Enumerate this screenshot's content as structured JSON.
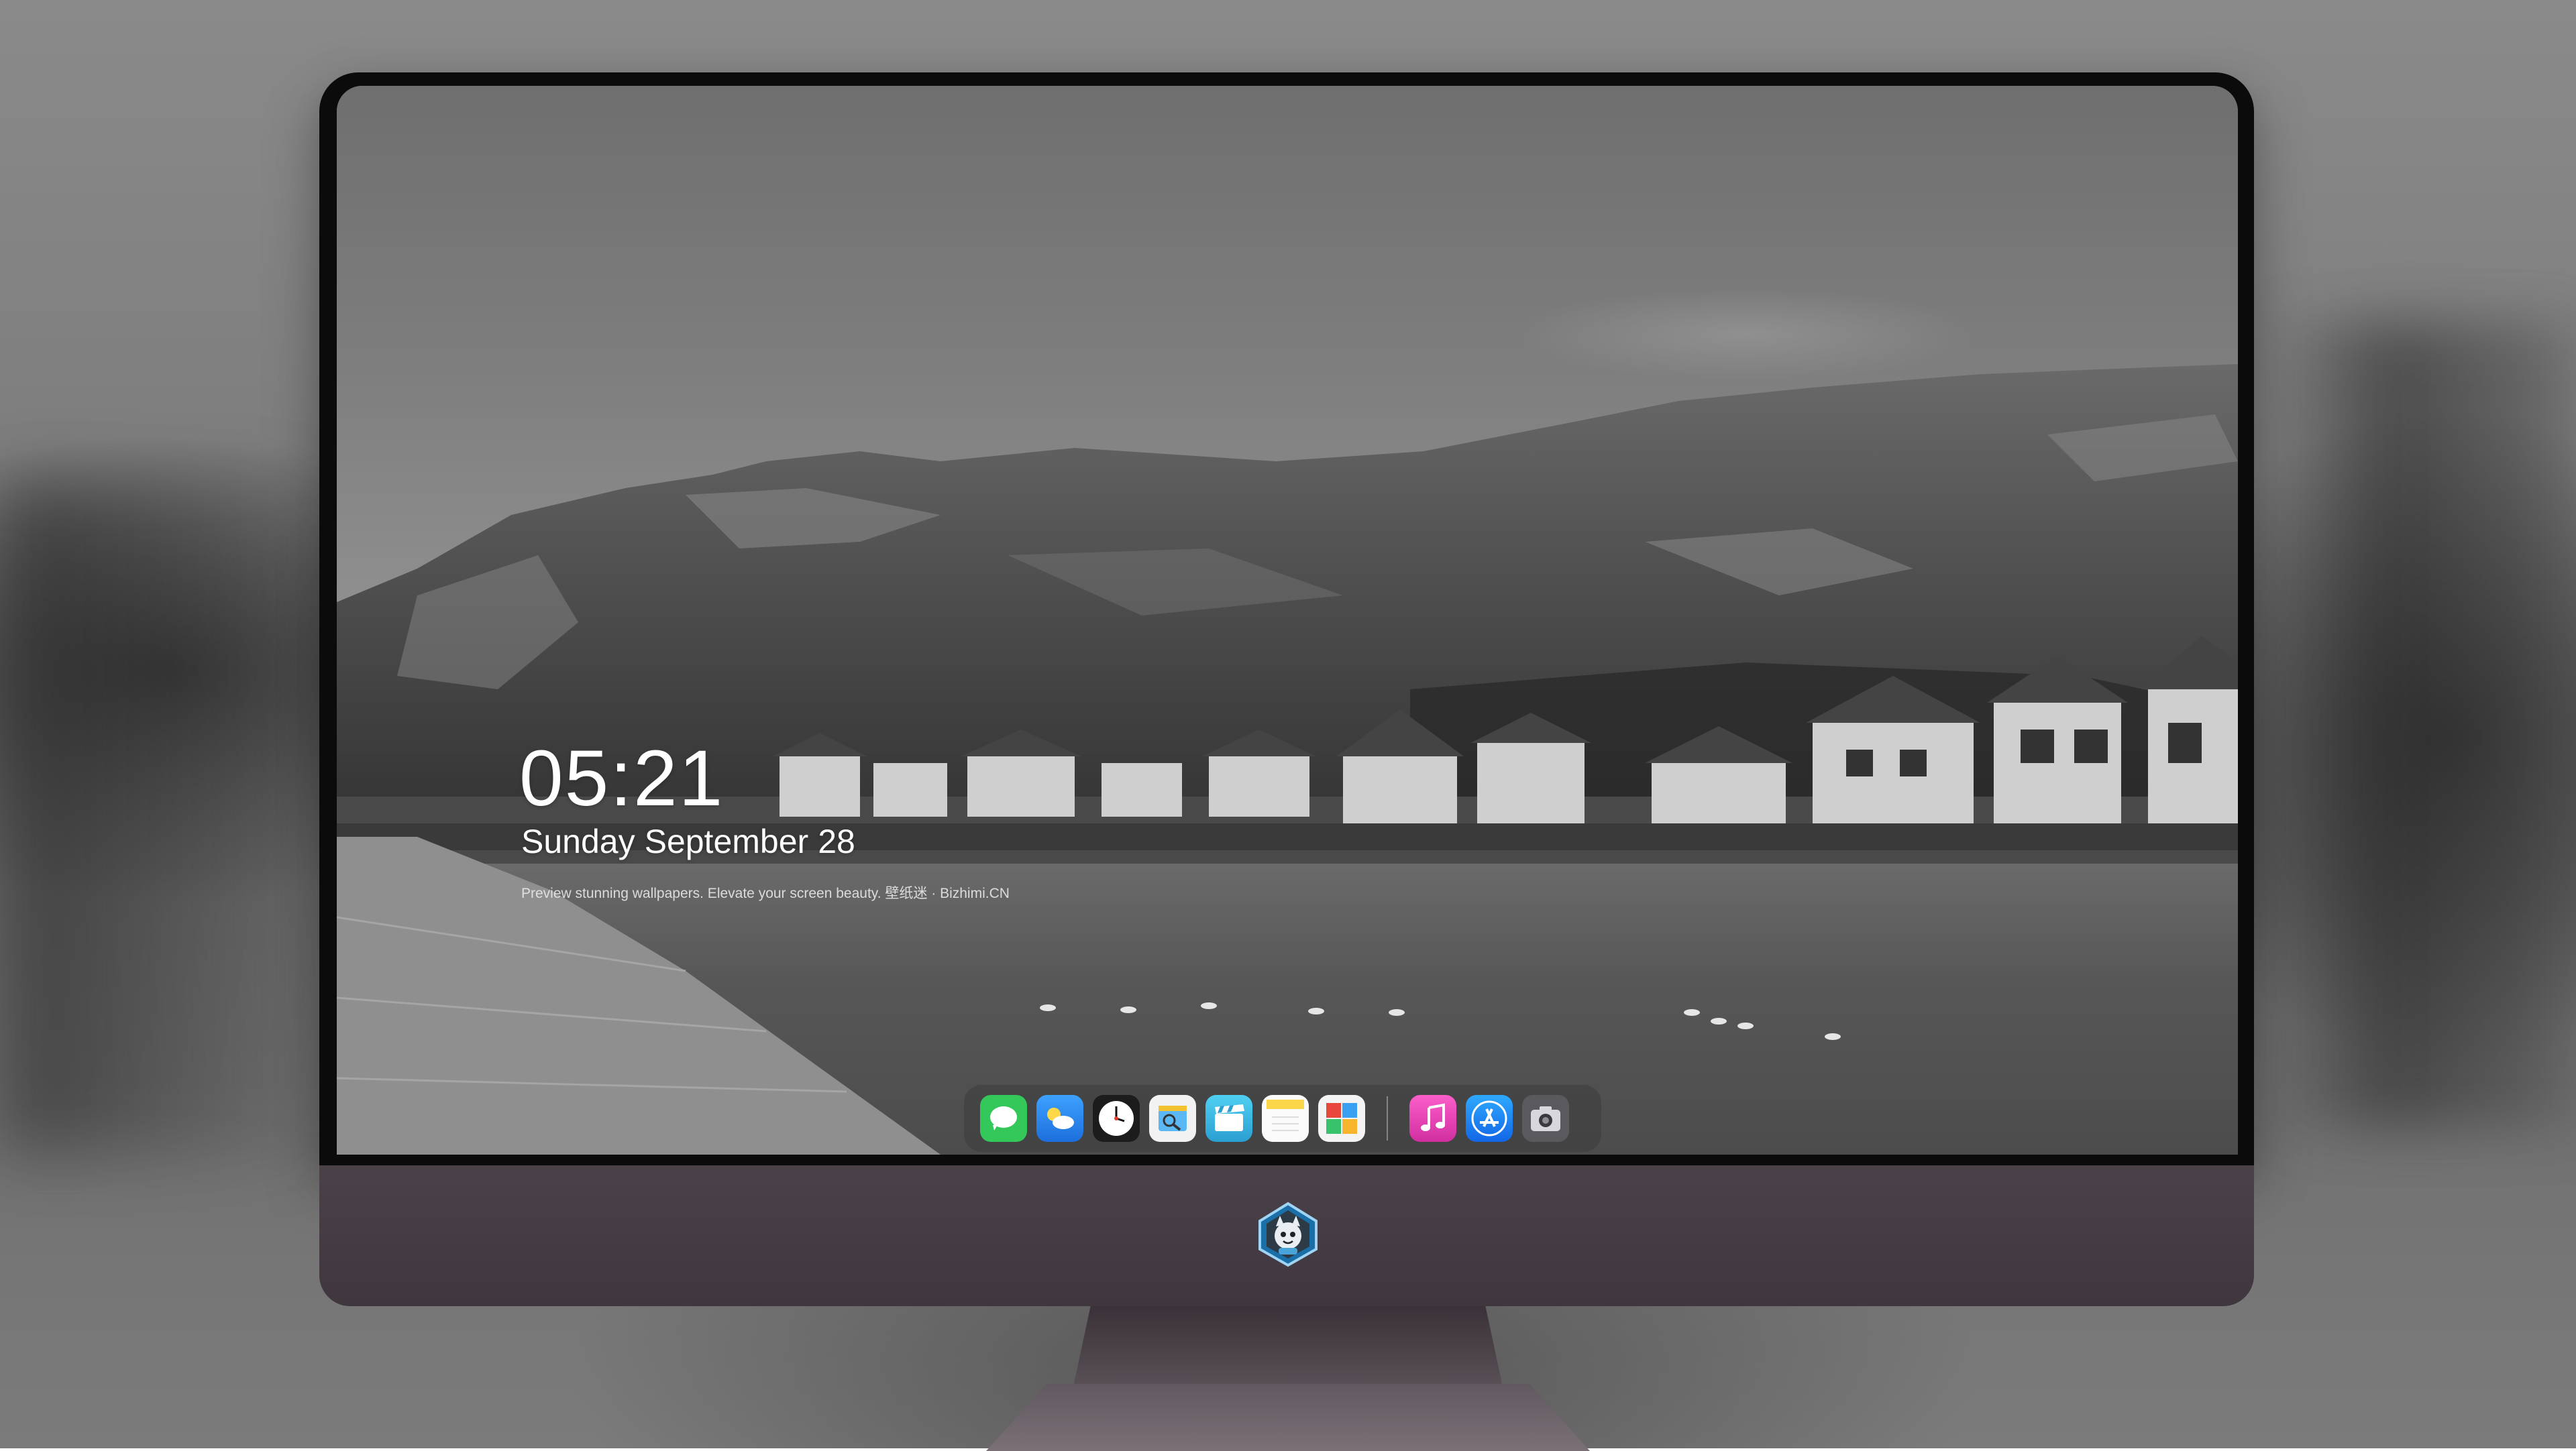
{
  "lockscreen": {
    "time": "05:21",
    "weekday": "Sunday",
    "month": "September",
    "day": "28",
    "caption": "Preview stunning wallpapers. Elevate your screen beauty. 壁纸迷 · Bizhimi.CN"
  },
  "dock": {
    "apps": [
      {
        "name": "messages-icon",
        "color": "#34c759"
      },
      {
        "name": "weather-icon",
        "color": "#2f8cf5"
      },
      {
        "name": "clock-icon",
        "color": "#ffffff"
      },
      {
        "name": "preview-icon",
        "color": "#f2c230"
      },
      {
        "name": "clips-icon",
        "color": "#37c1e6"
      },
      {
        "name": "notes-icon",
        "color": "#fcd64a"
      },
      {
        "name": "photo-booth-icon",
        "color": "#e8473b"
      },
      {
        "name": "music-icon",
        "color": "#f24fb0"
      },
      {
        "name": "app-store-icon",
        "color": "#1c8ef5"
      },
      {
        "name": "screenshot-icon",
        "color": "#8e8e93"
      }
    ]
  },
  "colors": {
    "bezel": "#0b0b0b",
    "chin": "#443b43",
    "dock_bg": "#3c3c3c"
  }
}
